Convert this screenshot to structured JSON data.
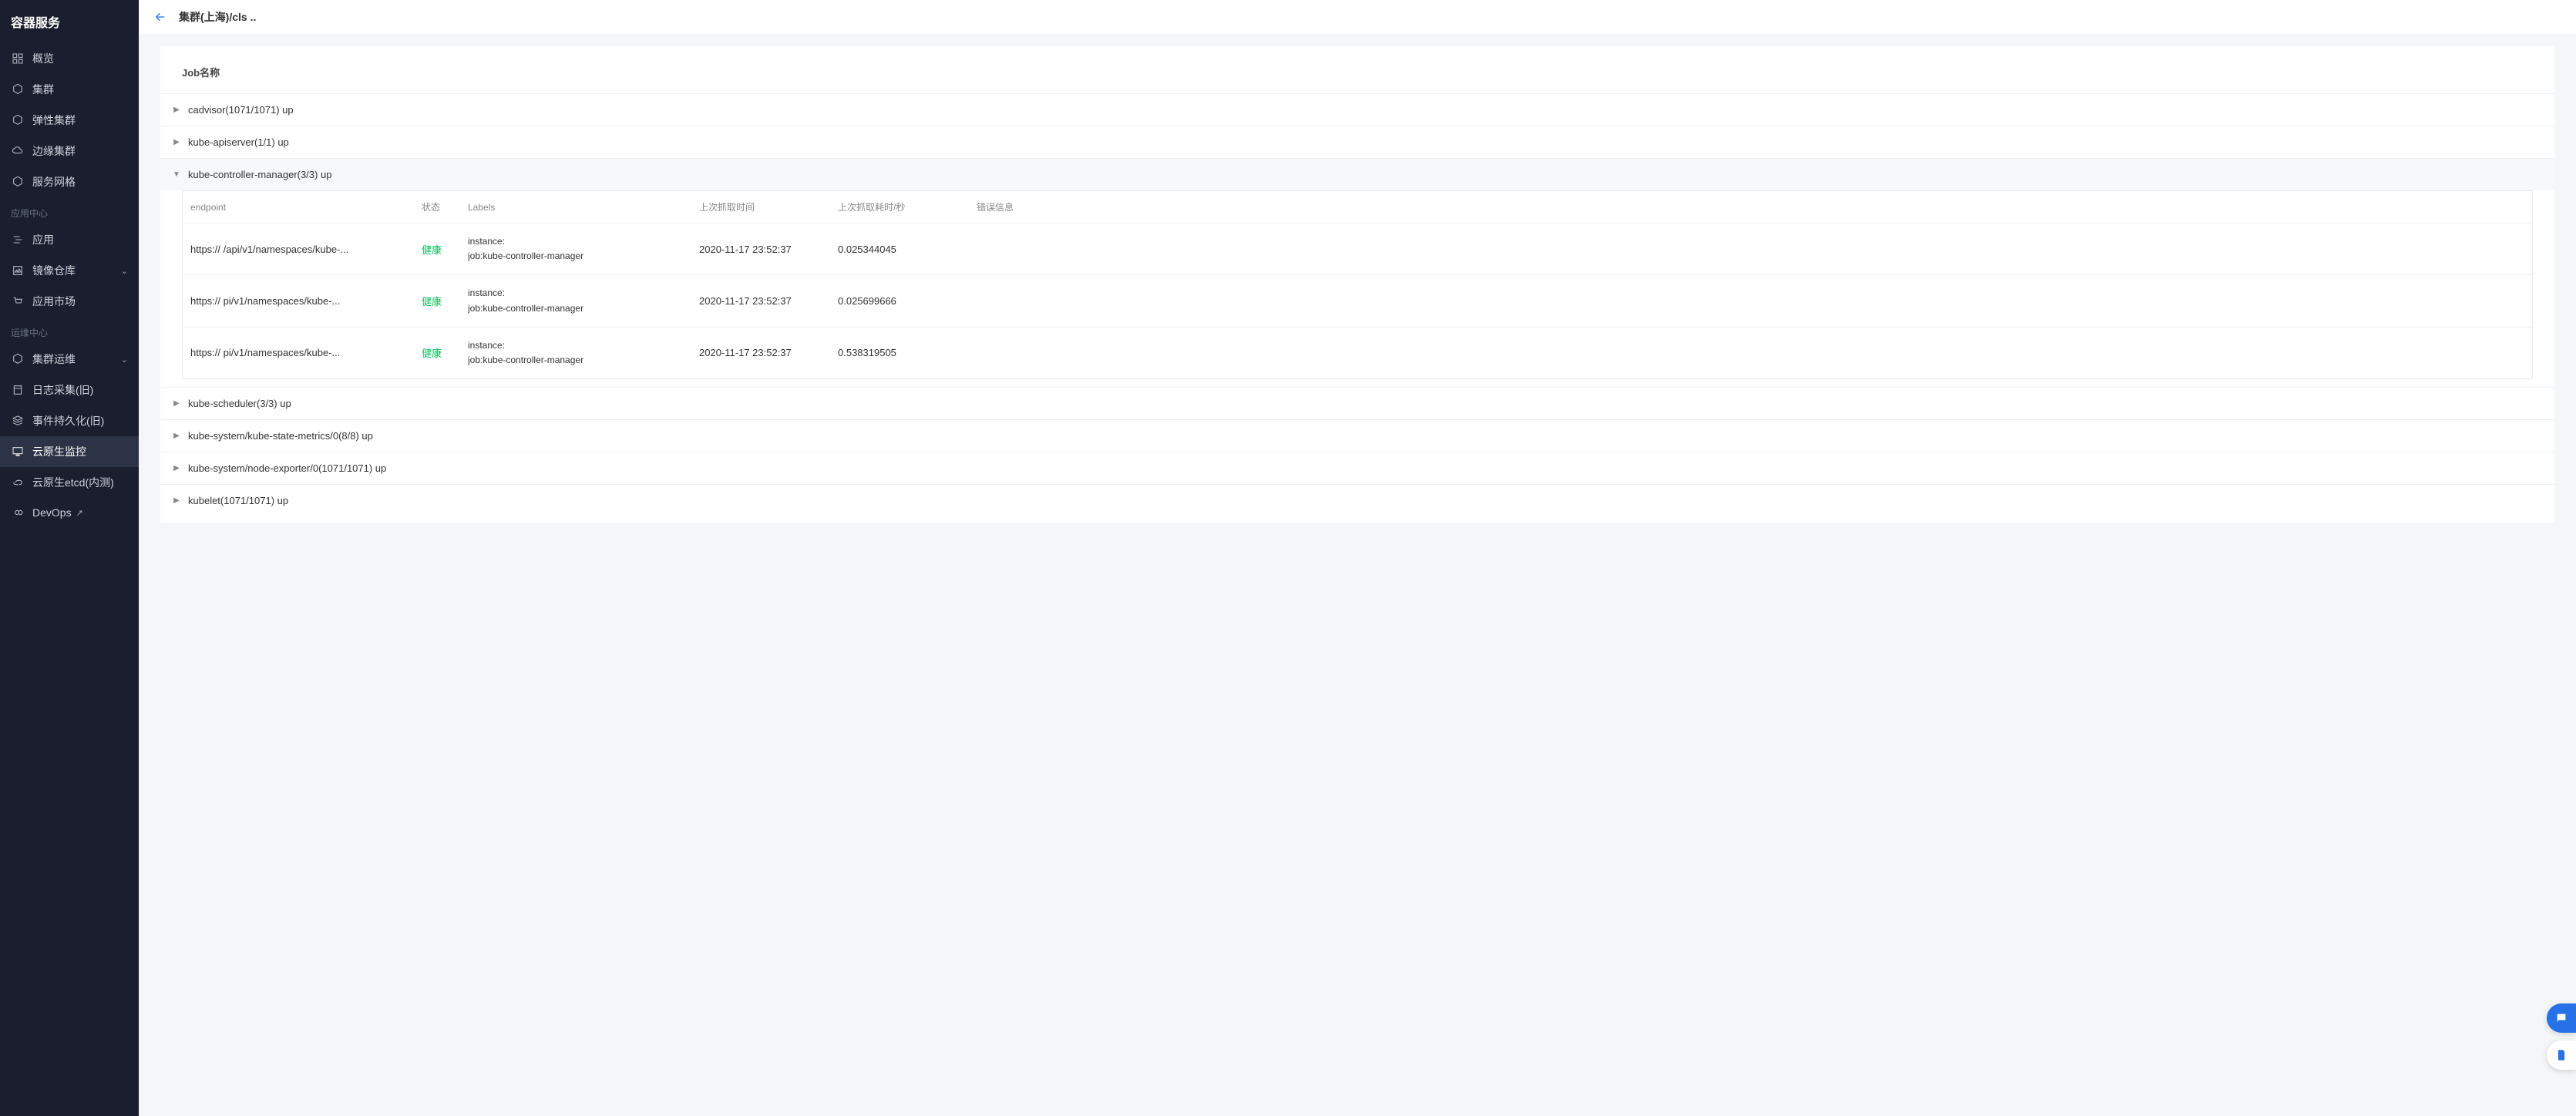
{
  "sidebar": {
    "title": "容器服务",
    "groups": [
      {
        "items": [
          {
            "icon": "grid",
            "label": "概览"
          },
          {
            "icon": "hex",
            "label": "集群"
          },
          {
            "icon": "hex",
            "label": "弹性集群"
          },
          {
            "icon": "cloud",
            "label": "边缘集群"
          },
          {
            "icon": "hex",
            "label": "服务网格"
          }
        ]
      },
      {
        "title": "应用中心",
        "items": [
          {
            "icon": "adjust",
            "label": "应用"
          },
          {
            "icon": "image",
            "label": "镜像仓库",
            "chev": true
          },
          {
            "icon": "cart",
            "label": "应用市场"
          }
        ]
      },
      {
        "title": "运维中心",
        "items": [
          {
            "icon": "hex",
            "label": "集群运维",
            "chev": true
          },
          {
            "icon": "cal",
            "label": "日志采集(旧)"
          },
          {
            "icon": "stack",
            "label": "事件持久化(旧)"
          },
          {
            "icon": "monitor",
            "label": "云原生监控",
            "active": true
          },
          {
            "icon": "link",
            "label": "云原生etcd(内测)"
          },
          {
            "icon": "inf",
            "label": "DevOps",
            "ext": true
          }
        ]
      }
    ]
  },
  "breadcrumb": "集群(上海)/cls ..",
  "card": {
    "header": "Job名称",
    "jobs": [
      {
        "name": "cadvisor(1071/1071) up",
        "expanded": false
      },
      {
        "name": "kube-apiserver(1/1) up",
        "expanded": false
      },
      {
        "name": "kube-controller-manager(3/3) up",
        "expanded": true
      },
      {
        "name": "kube-scheduler(3/3) up",
        "expanded": false
      },
      {
        "name": "kube-system/kube-state-metrics/0(8/8) up",
        "expanded": false
      },
      {
        "name": "kube-system/node-exporter/0(1071/1071) up",
        "expanded": false
      },
      {
        "name": "kubelet(1071/1071) up",
        "expanded": false
      }
    ],
    "table": {
      "headers": {
        "endpoint": "endpoint",
        "status": "状态",
        "labels": "Labels",
        "lastScrape": "上次抓取时间",
        "duration": "上次抓取耗时/秒",
        "error": "错误信息"
      },
      "rows": [
        {
          "endpoint": "https://             /api/v1/namespaces/kube-...",
          "status": "健康",
          "instance": "instance:                   ",
          "job": "job:kube-controller-manager",
          "time": "2020-11-17 23:52:37",
          "dur": "0.025344045",
          "err": ""
        },
        {
          "endpoint": "https://                 pi/v1/namespaces/kube-...",
          "status": "健康",
          "instance": "instance:                   ",
          "job": "job:kube-controller-manager",
          "time": "2020-11-17 23:52:37",
          "dur": "0.025699666",
          "err": ""
        },
        {
          "endpoint": "https://                 pi/v1/namespaces/kube-...",
          "status": "健康",
          "instance": "instance:                   ",
          "job": "job:kube-controller-manager",
          "time": "2020-11-17 23:52:37",
          "dur": "0.538319505",
          "err": ""
        }
      ]
    }
  }
}
